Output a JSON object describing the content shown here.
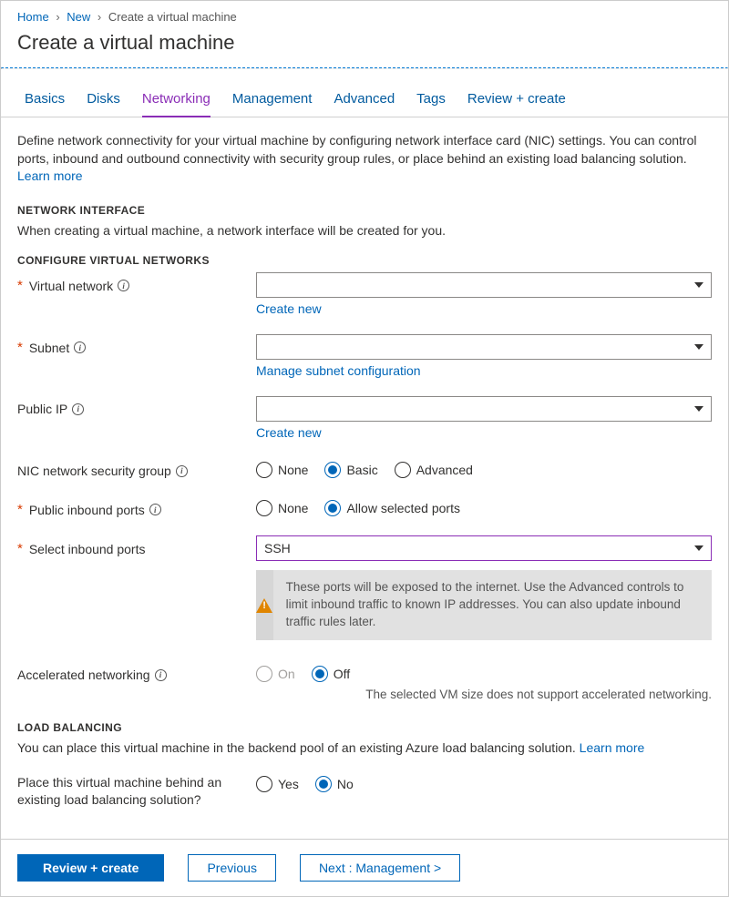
{
  "breadcrumb": {
    "home": "Home",
    "new": "New",
    "current": "Create a virtual machine"
  },
  "title": "Create a virtual machine",
  "tabs": {
    "basics": "Basics",
    "disks": "Disks",
    "networking": "Networking",
    "management": "Management",
    "advanced": "Advanced",
    "tags": "Tags",
    "review": "Review + create"
  },
  "intro": {
    "text": "Define network connectivity for your virtual machine by configuring network interface card (NIC) settings. You can control ports, inbound and outbound connectivity with security group rules, or place behind an existing load balancing solution.  ",
    "learn_more": "Learn more"
  },
  "sections": {
    "network_interface": {
      "head": "NETWORK INTERFACE",
      "sub": "When creating a virtual machine, a network interface will be created for you."
    },
    "configure_vn": {
      "head": "CONFIGURE VIRTUAL NETWORKS"
    },
    "load_balancing": {
      "head": "LOAD BALANCING",
      "sub": "You can place this virtual machine in the backend pool of an existing Azure load balancing solution.  ",
      "learn_more": "Learn more"
    }
  },
  "fields": {
    "vnet": {
      "label": "Virtual network",
      "value": "",
      "create": "Create new"
    },
    "subnet": {
      "label": "Subnet",
      "value": "",
      "manage": "Manage subnet configuration"
    },
    "public_ip": {
      "label": "Public IP",
      "value": "",
      "create": "Create new"
    },
    "nsg": {
      "label": "NIC network security group",
      "options": {
        "none": "None",
        "basic": "Basic",
        "advanced": "Advanced"
      }
    },
    "inbound_ports": {
      "label": "Public inbound ports",
      "options": {
        "none": "None",
        "allow": "Allow selected ports"
      }
    },
    "select_ports": {
      "label": "Select inbound ports",
      "value": "SSH"
    },
    "warning": "These ports will be exposed to the internet. Use the Advanced controls to limit inbound traffic to known IP addresses. You can also update inbound traffic rules later.",
    "accel_net": {
      "label": "Accelerated networking",
      "options": {
        "on": "On",
        "off": "Off"
      },
      "note": "The selected VM size does not support accelerated networking."
    },
    "lb_question": {
      "label": "Place this virtual machine behind an existing load balancing solution?",
      "options": {
        "yes": "Yes",
        "no": "No"
      }
    }
  },
  "footer": {
    "review": "Review + create",
    "previous": "Previous",
    "next": "Next : Management >"
  }
}
